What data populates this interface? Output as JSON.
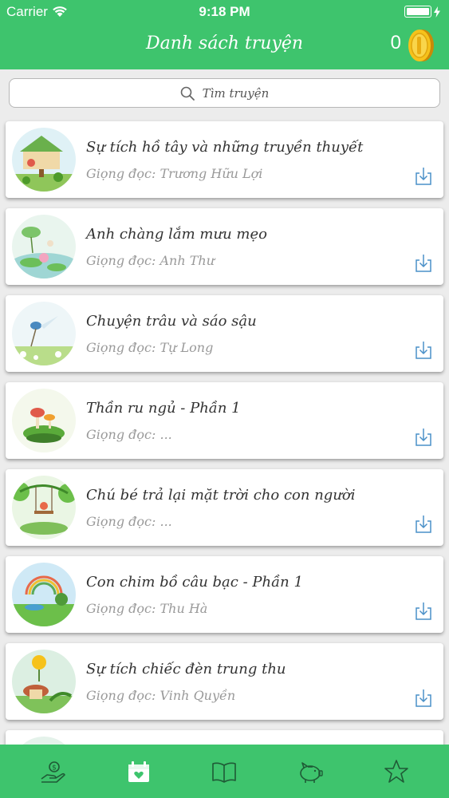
{
  "status_bar": {
    "carrier": "Carrier",
    "time": "9:18 PM"
  },
  "nav": {
    "title": "Danh sách truyện",
    "coins": "0"
  },
  "search": {
    "placeholder": "Tìm truyện"
  },
  "stories": [
    {
      "title": "Sự tích hồ tây và những truyền thuyết",
      "reader": "Giọng đọc: Trương Hữu Lợi",
      "thumb": "treehouse"
    },
    {
      "title": "Anh chàng lắm mưu mẹo",
      "reader": "Giọng đọc: Anh Thư",
      "thumb": "lilypad"
    },
    {
      "title": "Chuyện trâu và sáo sậu",
      "reader": "Giọng đọc: Tự Long",
      "thumb": "bird"
    },
    {
      "title": "Thần ru ngủ - Phần 1",
      "reader": "Giọng đọc: ...",
      "thumb": "mushroom-island"
    },
    {
      "title": "Chú bé trả lại mặt trời cho con người",
      "reader": "Giọng đọc: ...",
      "thumb": "swing"
    },
    {
      "title": "Con chim bồ câu bạc - Phần 1",
      "reader": "Giọng đọc: Thu Hà",
      "thumb": "rainbow"
    },
    {
      "title": "Sự tích chiếc đèn trung thu",
      "reader": "Giọng đọc: Vinh Quyền",
      "thumb": "sunflower-house"
    }
  ],
  "tabs": [
    {
      "name": "donate-hand-icon"
    },
    {
      "name": "gift-calendar-icon"
    },
    {
      "name": "book-icon"
    },
    {
      "name": "piggy-bank-icon"
    },
    {
      "name": "star-icon"
    }
  ],
  "colors": {
    "primary": "#3ec46d",
    "download": "#4a90c8",
    "background": "#ececec"
  }
}
